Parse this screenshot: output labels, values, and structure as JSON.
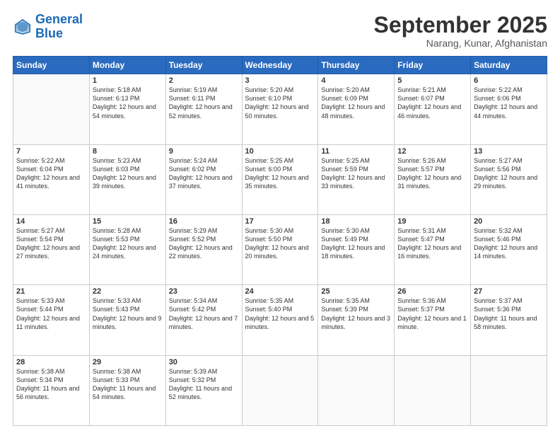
{
  "header": {
    "logo_general": "General",
    "logo_blue": "Blue",
    "main_title": "September 2025",
    "subtitle": "Narang, Kunar, Afghanistan"
  },
  "calendar": {
    "days_of_week": [
      "Sunday",
      "Monday",
      "Tuesday",
      "Wednesday",
      "Thursday",
      "Friday",
      "Saturday"
    ],
    "weeks": [
      [
        {
          "day": "",
          "sunrise": "",
          "sunset": "",
          "daylight": ""
        },
        {
          "day": "1",
          "sunrise": "Sunrise: 5:18 AM",
          "sunset": "Sunset: 6:13 PM",
          "daylight": "Daylight: 12 hours and 54 minutes."
        },
        {
          "day": "2",
          "sunrise": "Sunrise: 5:19 AM",
          "sunset": "Sunset: 6:11 PM",
          "daylight": "Daylight: 12 hours and 52 minutes."
        },
        {
          "day": "3",
          "sunrise": "Sunrise: 5:20 AM",
          "sunset": "Sunset: 6:10 PM",
          "daylight": "Daylight: 12 hours and 50 minutes."
        },
        {
          "day": "4",
          "sunrise": "Sunrise: 5:20 AM",
          "sunset": "Sunset: 6:09 PM",
          "daylight": "Daylight: 12 hours and 48 minutes."
        },
        {
          "day": "5",
          "sunrise": "Sunrise: 5:21 AM",
          "sunset": "Sunset: 6:07 PM",
          "daylight": "Daylight: 12 hours and 46 minutes."
        },
        {
          "day": "6",
          "sunrise": "Sunrise: 5:22 AM",
          "sunset": "Sunset: 6:06 PM",
          "daylight": "Daylight: 12 hours and 44 minutes."
        }
      ],
      [
        {
          "day": "7",
          "sunrise": "Sunrise: 5:22 AM",
          "sunset": "Sunset: 6:04 PM",
          "daylight": "Daylight: 12 hours and 41 minutes."
        },
        {
          "day": "8",
          "sunrise": "Sunrise: 5:23 AM",
          "sunset": "Sunset: 6:03 PM",
          "daylight": "Daylight: 12 hours and 39 minutes."
        },
        {
          "day": "9",
          "sunrise": "Sunrise: 5:24 AM",
          "sunset": "Sunset: 6:02 PM",
          "daylight": "Daylight: 12 hours and 37 minutes."
        },
        {
          "day": "10",
          "sunrise": "Sunrise: 5:25 AM",
          "sunset": "Sunset: 6:00 PM",
          "daylight": "Daylight: 12 hours and 35 minutes."
        },
        {
          "day": "11",
          "sunrise": "Sunrise: 5:25 AM",
          "sunset": "Sunset: 5:59 PM",
          "daylight": "Daylight: 12 hours and 33 minutes."
        },
        {
          "day": "12",
          "sunrise": "Sunrise: 5:26 AM",
          "sunset": "Sunset: 5:57 PM",
          "daylight": "Daylight: 12 hours and 31 minutes."
        },
        {
          "day": "13",
          "sunrise": "Sunrise: 5:27 AM",
          "sunset": "Sunset: 5:56 PM",
          "daylight": "Daylight: 12 hours and 29 minutes."
        }
      ],
      [
        {
          "day": "14",
          "sunrise": "Sunrise: 5:27 AM",
          "sunset": "Sunset: 5:54 PM",
          "daylight": "Daylight: 12 hours and 27 minutes."
        },
        {
          "day": "15",
          "sunrise": "Sunrise: 5:28 AM",
          "sunset": "Sunset: 5:53 PM",
          "daylight": "Daylight: 12 hours and 24 minutes."
        },
        {
          "day": "16",
          "sunrise": "Sunrise: 5:29 AM",
          "sunset": "Sunset: 5:52 PM",
          "daylight": "Daylight: 12 hours and 22 minutes."
        },
        {
          "day": "17",
          "sunrise": "Sunrise: 5:30 AM",
          "sunset": "Sunset: 5:50 PM",
          "daylight": "Daylight: 12 hours and 20 minutes."
        },
        {
          "day": "18",
          "sunrise": "Sunrise: 5:30 AM",
          "sunset": "Sunset: 5:49 PM",
          "daylight": "Daylight: 12 hours and 18 minutes."
        },
        {
          "day": "19",
          "sunrise": "Sunrise: 5:31 AM",
          "sunset": "Sunset: 5:47 PM",
          "daylight": "Daylight: 12 hours and 16 minutes."
        },
        {
          "day": "20",
          "sunrise": "Sunrise: 5:32 AM",
          "sunset": "Sunset: 5:46 PM",
          "daylight": "Daylight: 12 hours and 14 minutes."
        }
      ],
      [
        {
          "day": "21",
          "sunrise": "Sunrise: 5:33 AM",
          "sunset": "Sunset: 5:44 PM",
          "daylight": "Daylight: 12 hours and 11 minutes."
        },
        {
          "day": "22",
          "sunrise": "Sunrise: 5:33 AM",
          "sunset": "Sunset: 5:43 PM",
          "daylight": "Daylight: 12 hours and 9 minutes."
        },
        {
          "day": "23",
          "sunrise": "Sunrise: 5:34 AM",
          "sunset": "Sunset: 5:42 PM",
          "daylight": "Daylight: 12 hours and 7 minutes."
        },
        {
          "day": "24",
          "sunrise": "Sunrise: 5:35 AM",
          "sunset": "Sunset: 5:40 PM",
          "daylight": "Daylight: 12 hours and 5 minutes."
        },
        {
          "day": "25",
          "sunrise": "Sunrise: 5:35 AM",
          "sunset": "Sunset: 5:39 PM",
          "daylight": "Daylight: 12 hours and 3 minutes."
        },
        {
          "day": "26",
          "sunrise": "Sunrise: 5:36 AM",
          "sunset": "Sunset: 5:37 PM",
          "daylight": "Daylight: 12 hours and 1 minute."
        },
        {
          "day": "27",
          "sunrise": "Sunrise: 5:37 AM",
          "sunset": "Sunset: 5:36 PM",
          "daylight": "Daylight: 11 hours and 58 minutes."
        }
      ],
      [
        {
          "day": "28",
          "sunrise": "Sunrise: 5:38 AM",
          "sunset": "Sunset: 5:34 PM",
          "daylight": "Daylight: 11 hours and 56 minutes."
        },
        {
          "day": "29",
          "sunrise": "Sunrise: 5:38 AM",
          "sunset": "Sunset: 5:33 PM",
          "daylight": "Daylight: 11 hours and 54 minutes."
        },
        {
          "day": "30",
          "sunrise": "Sunrise: 5:39 AM",
          "sunset": "Sunset: 5:32 PM",
          "daylight": "Daylight: 11 hours and 52 minutes."
        },
        {
          "day": "",
          "sunrise": "",
          "sunset": "",
          "daylight": ""
        },
        {
          "day": "",
          "sunrise": "",
          "sunset": "",
          "daylight": ""
        },
        {
          "day": "",
          "sunrise": "",
          "sunset": "",
          "daylight": ""
        },
        {
          "day": "",
          "sunrise": "",
          "sunset": "",
          "daylight": ""
        }
      ]
    ]
  }
}
